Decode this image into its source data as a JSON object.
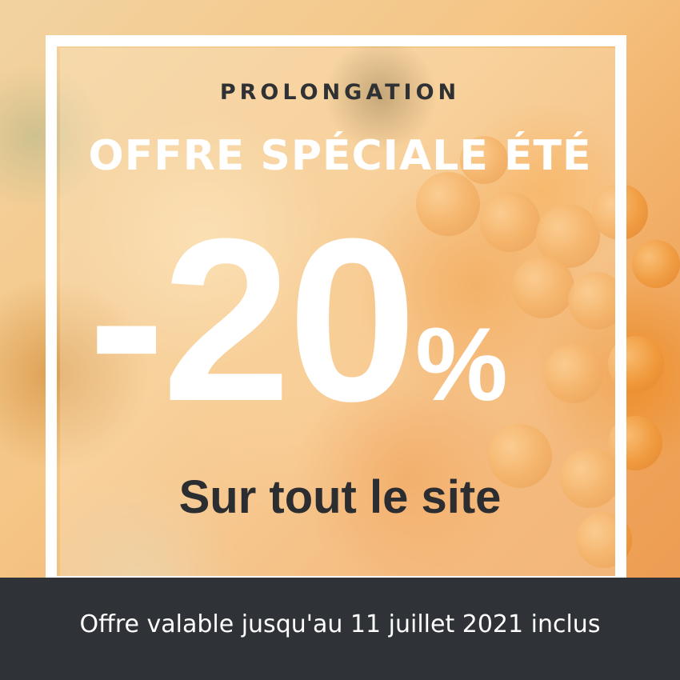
{
  "promo": {
    "kicker": "PROLONGATION",
    "headline": "OFFRE SPÉCIALE ÉTÉ",
    "discount_value": "-20",
    "discount_unit": "%",
    "subline": "Sur tout le site",
    "footer_note": "Offre valable jusqu'au 11 juillet 2021 inclus"
  },
  "colors": {
    "frame": "#ffffff",
    "dark_text": "#2f3134",
    "footer_background": "#2f3236",
    "accent_orange": "#f09a3c"
  }
}
